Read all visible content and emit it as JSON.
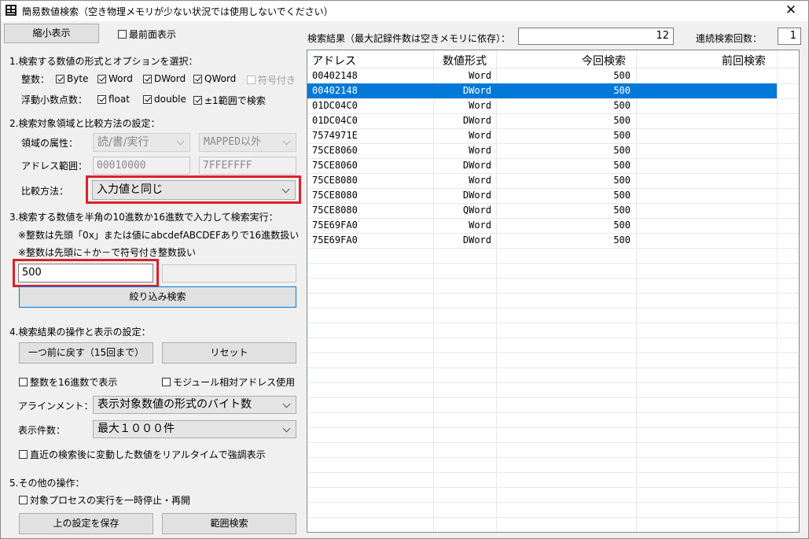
{
  "window": {
    "title": "簡易数値検索（空き物理メモリが少ない状況では使用しないでください）",
    "close_glyph": "✕"
  },
  "top": {
    "shrink_button": "縮小表示",
    "topmost": {
      "label": "最前面表示",
      "checked": false
    }
  },
  "section1": {
    "heading": "1.検索する数値の形式とオプションを選択：",
    "int_label": "整数：",
    "int_options": [
      {
        "label": "Byte",
        "checked": true,
        "enabled": true
      },
      {
        "label": "Word",
        "checked": true,
        "enabled": true
      },
      {
        "label": "DWord",
        "checked": true,
        "enabled": true
      },
      {
        "label": "QWord",
        "checked": true,
        "enabled": true
      },
      {
        "label": "符号付き",
        "checked": false,
        "enabled": false
      }
    ],
    "float_label": "浮動小数点数：",
    "float_options": [
      {
        "label": "float",
        "checked": true
      },
      {
        "label": "double",
        "checked": true
      },
      {
        "label": "±1範囲で検索",
        "checked": true
      }
    ]
  },
  "section2": {
    "heading": "2.検索対象領域と比較方法の設定：",
    "attr_label": "領域の属性：",
    "attr_value": "読/書/実行",
    "mapped_value": "MAPPED以外",
    "range_label": "アドレス範囲：",
    "range_start": "00010000",
    "range_end": "7FFEFFFF",
    "compare_label": "比較方法：",
    "compare_value": "入力値と同じ"
  },
  "section3": {
    "heading": "3.検索する数値を半角の10進数か16進数で入力して検索実行：",
    "note1": "※整数は先頭「0x」または値にabcdefABCDEFありで16進数扱い",
    "note2": "※整数は先頭に＋か－で符号付き整数扱い",
    "input_value": "500",
    "second_input_value": "",
    "search_button": "絞り込み検索"
  },
  "section4": {
    "heading": "4.検索結果の操作と表示の設定：",
    "undo_button": "一つ前に戻す（15回まで）",
    "reset_button": "リセット",
    "hex_option": {
      "label": "整数を16進数で表示",
      "checked": false
    },
    "module_option": {
      "label": "モジュール相対アドレス使用",
      "checked": false
    },
    "align_label": "アラインメント：",
    "align_value": "表示対象数値の形式のバイト数",
    "count_label": "表示件数：",
    "count_value": "最大１０００件",
    "highlight_option": {
      "label": "直近の検索後に変動した数値をリアルタイムで強調表示",
      "checked": false
    }
  },
  "section5": {
    "heading": "5.その他の操作：",
    "pause_option": {
      "label": "対象プロセスの実行を一時停止・再開",
      "checked": false
    },
    "save_button": "上の設定を保存",
    "range_search_button": "範囲検索"
  },
  "results": {
    "summary_label": "検索結果（最大記録件数は空きメモリに依存）：",
    "count_value": "12",
    "repeat_label": "連続検索回数：",
    "repeat_value": "1",
    "columns": [
      "アドレス",
      "数値形式",
      "今回検索",
      "前回検索"
    ],
    "rows": [
      {
        "address": "00402148",
        "type": "Word",
        "current": "500",
        "previous": "",
        "selected": false
      },
      {
        "address": "00402148",
        "type": "DWord",
        "current": "500",
        "previous": "",
        "selected": true
      },
      {
        "address": "01DC04C0",
        "type": "Word",
        "current": "500",
        "previous": "",
        "selected": false
      },
      {
        "address": "01DC04C0",
        "type": "DWord",
        "current": "500",
        "previous": "",
        "selected": false
      },
      {
        "address": "7574971E",
        "type": "Word",
        "current": "500",
        "previous": "",
        "selected": false
      },
      {
        "address": "75CE8060",
        "type": "Word",
        "current": "500",
        "previous": "",
        "selected": false
      },
      {
        "address": "75CE8060",
        "type": "DWord",
        "current": "500",
        "previous": "",
        "selected": false
      },
      {
        "address": "75CE8080",
        "type": "Word",
        "current": "500",
        "previous": "",
        "selected": false
      },
      {
        "address": "75CE8080",
        "type": "DWord",
        "current": "500",
        "previous": "",
        "selected": false
      },
      {
        "address": "75CE8080",
        "type": "QWord",
        "current": "500",
        "previous": "",
        "selected": false
      },
      {
        "address": "75E69FA0",
        "type": "Word",
        "current": "500",
        "previous": "",
        "selected": false
      },
      {
        "address": "75E69FA0",
        "type": "DWord",
        "current": "500",
        "previous": "",
        "selected": false
      }
    ]
  },
  "colors": {
    "selection": "#0078d7",
    "highlight_frame": "#e0202a",
    "window_bg": "#f0f0f0"
  }
}
